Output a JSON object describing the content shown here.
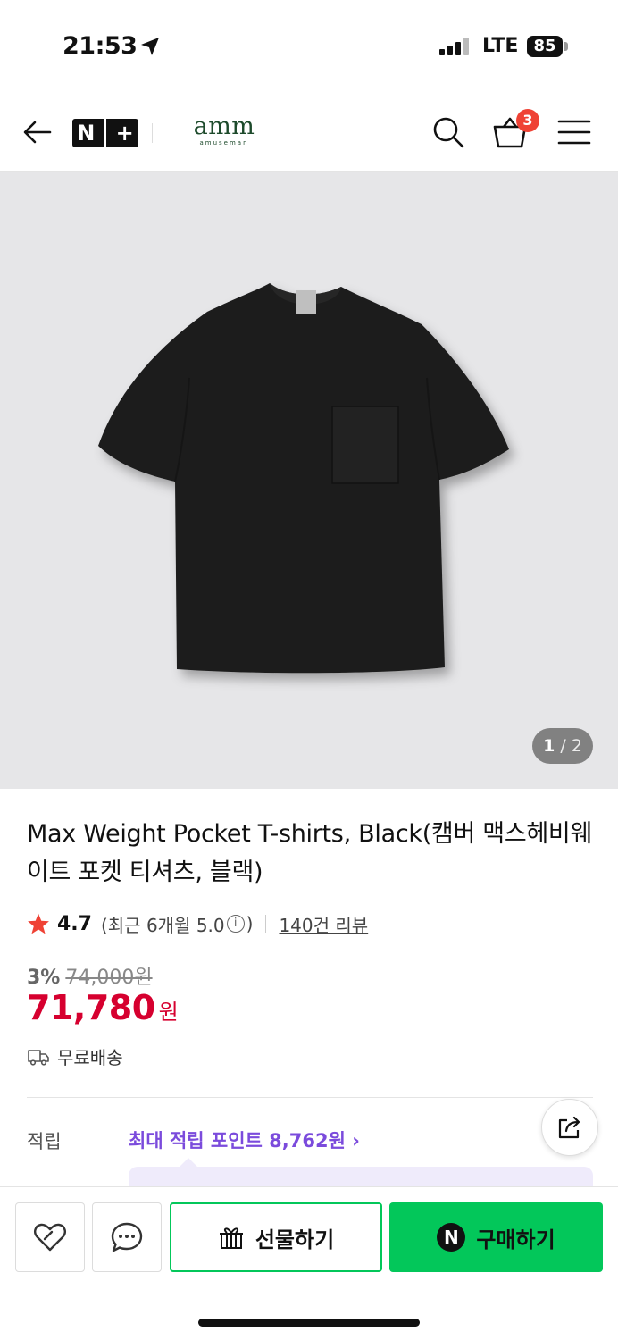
{
  "status_bar": {
    "time": "21:53",
    "network": "LTE",
    "battery": "85"
  },
  "header": {
    "nplus_left": "N",
    "nplus_right": "+",
    "brand_name": "amm",
    "brand_sub": "amuseman",
    "cart_count": "3"
  },
  "gallery": {
    "current": "1",
    "separator": "/",
    "total": "2"
  },
  "product": {
    "title": "Max Weight Pocket T-shirts, Black(캠버 맥스헤비웨이트 포켓 티셔츠, 블랙)",
    "rating": "4.7",
    "recent_rating_prefix": "(최근 6개월 5.0",
    "recent_rating_suffix": ")",
    "info_glyph": "i",
    "review_count": "140건 리뷰",
    "discount_percent": "3%",
    "original_price": "74,000원",
    "price": "71,780",
    "currency": "원",
    "shipping": "무료배송",
    "points_label": "적립",
    "points_text": "최대 적립 포인트 8,762원 ›"
  },
  "actions": {
    "gift_label": "선물하기",
    "buy_label": "구매하기",
    "npay_glyph": "N"
  },
  "colors": {
    "brand_green": "#03c75a",
    "price_red": "#d6002f",
    "points_purple": "#7b4bdc",
    "badge_red": "#ef4235"
  }
}
